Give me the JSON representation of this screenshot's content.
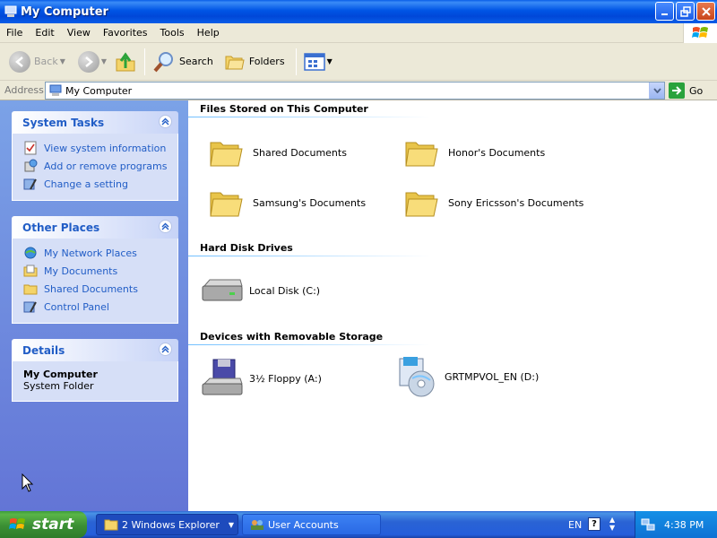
{
  "window": {
    "title": "My Computer",
    "icon": "my-computer-icon"
  },
  "menu": [
    "File",
    "Edit",
    "View",
    "Favorites",
    "Tools",
    "Help"
  ],
  "toolbar": {
    "back": "Back",
    "search": "Search",
    "folders": "Folders"
  },
  "address": {
    "label": "Address",
    "value": "My Computer",
    "go": "Go"
  },
  "sidebar": {
    "system_tasks": {
      "title": "System Tasks",
      "items": [
        "View system information",
        "Add or remove programs",
        "Change a setting"
      ]
    },
    "other_places": {
      "title": "Other Places",
      "items": [
        "My Network Places",
        "My Documents",
        "Shared Documents",
        "Control Panel"
      ]
    },
    "details": {
      "title": "Details",
      "name": "My Computer",
      "type": "System Folder"
    }
  },
  "content": {
    "files_group": "Files Stored on This Computer",
    "files": [
      "Shared Documents",
      "Honor's Documents",
      "Samsung's Documents",
      "Sony Ericsson's Documents"
    ],
    "disks_group": "Hard Disk Drives",
    "disks": [
      "Local Disk (C:)"
    ],
    "removable_group": "Devices with Removable Storage",
    "removable": [
      "3½ Floppy (A:)",
      "GRTMPVOL_EN (D:)"
    ]
  },
  "taskbar": {
    "start": "start",
    "task1": "2 Windows Explorer",
    "task2": "User Accounts",
    "lang": "EN",
    "help": "?",
    "clock": "4:38 PM"
  },
  "colors": {
    "titlebar": "#0055e5",
    "link": "#215dc6",
    "start": "#3b8f34"
  }
}
